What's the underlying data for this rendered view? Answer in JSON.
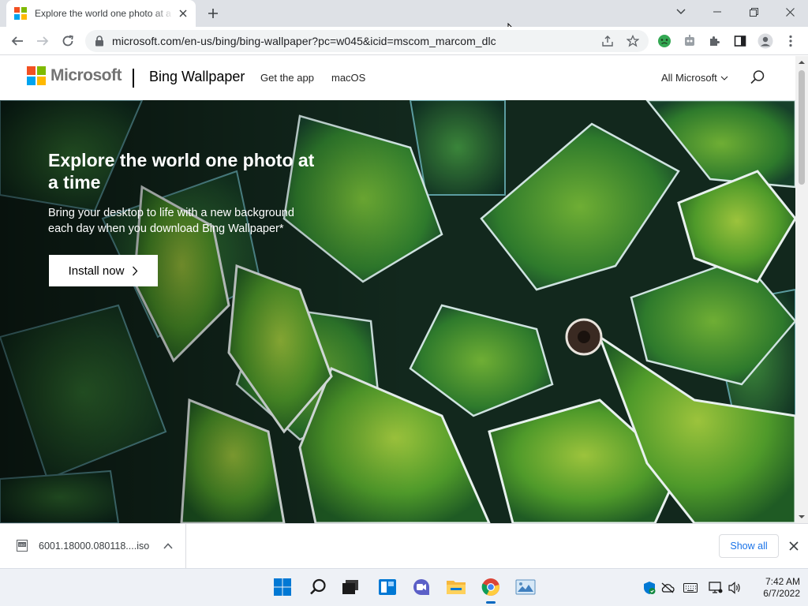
{
  "browser": {
    "tab_title": "Explore the world one photo at a time",
    "url": "microsoft.com/en-us/bing/bing-wallpaper?pc=w045&icid=mscom_marcom_dlc"
  },
  "site": {
    "brand": "Microsoft",
    "product": "Bing Wallpaper",
    "nav": [
      "Get the app",
      "macOS"
    ],
    "all_microsoft": "All Microsoft",
    "logo_colors": [
      "#f25022",
      "#7fba00",
      "#00a4ef",
      "#ffb900"
    ]
  },
  "hero": {
    "title": "Explore the world one photo at a time",
    "subtitle": "Bring your desktop to life with a new background each day when you download Bing Wallpaper*",
    "cta": "Install now"
  },
  "download": {
    "filename": "6001.18000.080118....iso",
    "show_all": "Show all"
  },
  "taskbar": {
    "time": "7:42 AM",
    "date": "6/7/2022",
    "apps": [
      "start-icon",
      "search-icon",
      "task-view-icon",
      "widgets-icon",
      "chat-icon",
      "file-explorer-icon",
      "chrome-icon",
      "photos-icon"
    ]
  }
}
